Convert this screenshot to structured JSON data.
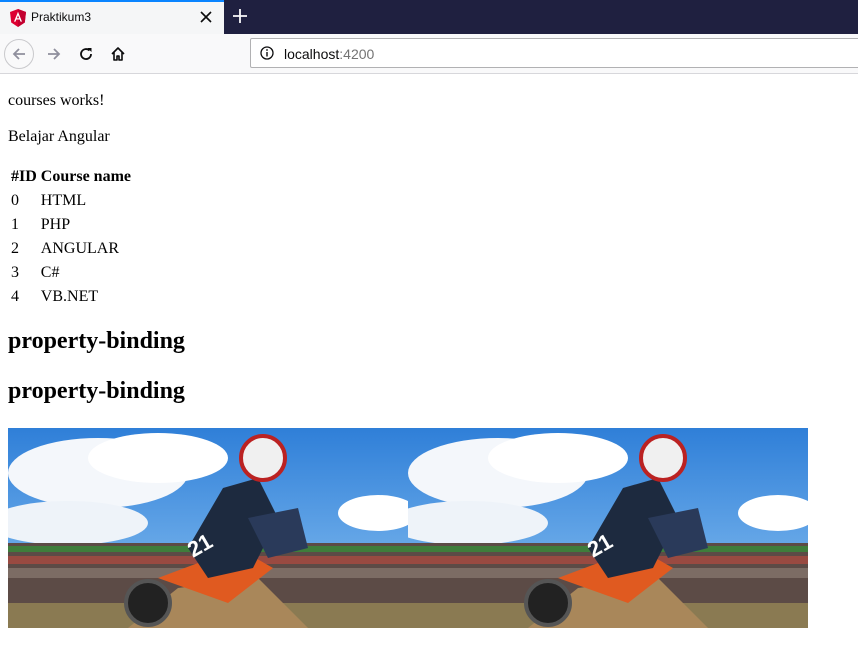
{
  "browser": {
    "tab": {
      "title": "Praktikum3"
    },
    "url": {
      "host": "localhost",
      "port": ":4200"
    }
  },
  "page": {
    "courses_text": "courses works!",
    "subtitle": "Belajar Angular",
    "table": {
      "headers": [
        "#ID",
        "Course name"
      ],
      "rows": [
        [
          "0",
          "HTML"
        ],
        [
          "1",
          "PHP"
        ],
        [
          "2",
          "ANGULAR"
        ],
        [
          "3",
          "C#"
        ],
        [
          "4",
          "VB.NET"
        ]
      ]
    },
    "heading1": "property-binding",
    "heading2": "property-binding",
    "images": [
      "motocross-photo",
      "motocross-photo"
    ]
  },
  "colors": {
    "tab_accent": "#0a84ff",
    "tabbar_bg": "#1f2040",
    "angular_red": "#dd0031"
  }
}
